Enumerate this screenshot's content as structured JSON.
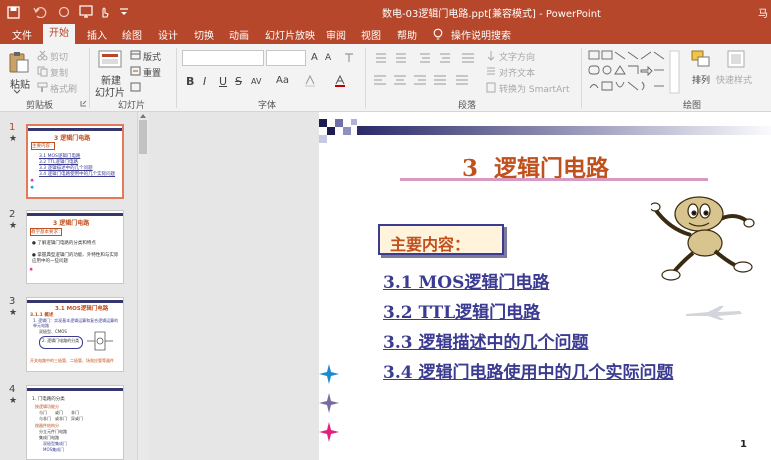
{
  "titlebar": {
    "title": "数电-03逻辑门电路.ppt[兼容模式] - PowerPoint",
    "user": "马"
  },
  "tabs": [
    "文件",
    "开始",
    "插入",
    "绘图",
    "设计",
    "切换",
    "动画",
    "幻灯片放映",
    "审阅",
    "视图",
    "帮助",
    "操作说明搜索"
  ],
  "active_tab": "开始",
  "ribbon": {
    "clipboard": {
      "paste": "粘贴",
      "cut": "剪切",
      "copy": "复制",
      "format_painter": "格式刷",
      "group": "剪贴板"
    },
    "slides": {
      "new_slide_1": "新建",
      "new_slide_2": "幻灯片",
      "layout": "版式",
      "reset": "重置",
      "group": "幻灯片"
    },
    "font": {
      "bold": "B",
      "italic": "I",
      "underline": "U",
      "strike": "S",
      "spacing": "AV",
      "case": "Aa",
      "group": "字体"
    },
    "paragraph": {
      "text_direction": "文字方向",
      "align_text": "对齐文本",
      "smartart": "转换为 SmartArt",
      "group": "段落"
    },
    "drawing": {
      "arrange": "排列",
      "quick_styles": "快速样式",
      "group": "绘图"
    }
  },
  "thumbnails": [
    {
      "num": "1",
      "title": "3 逻辑门电路",
      "sub": "主要内容：",
      "lines": [
        "3.1 MOS逻辑门电路",
        "3.2 TTL逻辑门电路",
        "3.3 逻辑描述中的几个问题",
        "3.4 逻辑门电路使用中的几个实际问题"
      ]
    },
    {
      "num": "2",
      "title": "3 逻辑门电路",
      "sub": "教学基本要求：",
      "lines": [
        "● 了解逻辑门电路的分类和特点",
        "● 掌握典型逻辑门的功能、外特性和与实际应用中的一些问题"
      ]
    },
    {
      "num": "3",
      "title": "3.1 MOS逻辑门电路",
      "sub": "3.1.1 概述",
      "lines": [
        "1. 逻辑门：实现基本逻辑运算和复合逻辑运算的单元电路",
        "双极型、CMOS",
        "2. 逻辑门电路的分类",
        "开关电路中的三极管、二极管、场效应管等器件"
      ]
    },
    {
      "num": "4",
      "title": "1. 门电路的分类",
      "sub": "",
      "lines": [
        "按逻辑功能分",
        "与门　　或门　　非门",
        "与非门　或非门　异或门",
        "按器件结构分",
        "分立元件门电路",
        "集成门电路",
        "双极型集成门",
        "MOS集成门"
      ]
    }
  ],
  "slide": {
    "title": "3  逻辑门电路",
    "subtitle": "主要内容：",
    "items": [
      "3.1  MOS逻辑门电路",
      "3.2 TTL逻辑门电路",
      "3.3 逻辑描述中的几个问题",
      "3.4 逻辑门电路使用中的几个实际问题"
    ],
    "page_number": "1"
  },
  "colors": {
    "brand": "#b7472a",
    "title": "#c0501c",
    "link": "#3b3b91",
    "rule": "#d99ac2"
  }
}
